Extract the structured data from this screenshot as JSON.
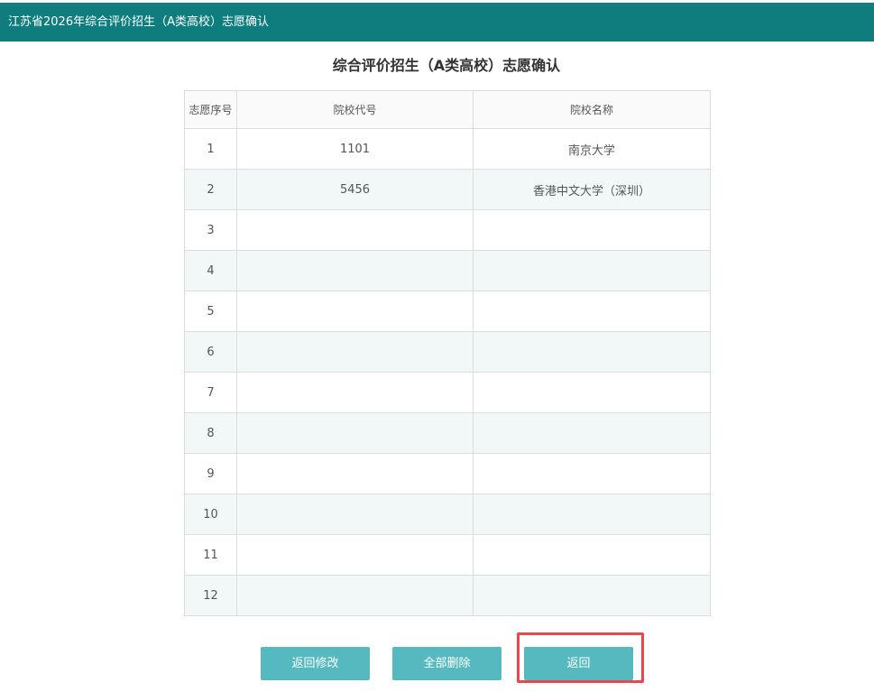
{
  "header": {
    "title": "江苏省2026年综合评价招生（A类高校）志愿确认"
  },
  "page": {
    "title": "综合评价招生（A类高校）志愿确认"
  },
  "table": {
    "columns": [
      "志愿序号",
      "院校代号",
      "院校名称"
    ],
    "rows": [
      {
        "seq": "1",
        "code": "1101",
        "name": "南京大学"
      },
      {
        "seq": "2",
        "code": "5456",
        "name": "香港中文大学（深圳）"
      },
      {
        "seq": "3",
        "code": "",
        "name": ""
      },
      {
        "seq": "4",
        "code": "",
        "name": ""
      },
      {
        "seq": "5",
        "code": "",
        "name": ""
      },
      {
        "seq": "6",
        "code": "",
        "name": ""
      },
      {
        "seq": "7",
        "code": "",
        "name": ""
      },
      {
        "seq": "8",
        "code": "",
        "name": ""
      },
      {
        "seq": "9",
        "code": "",
        "name": ""
      },
      {
        "seq": "10",
        "code": "",
        "name": ""
      },
      {
        "seq": "11",
        "code": "",
        "name": ""
      },
      {
        "seq": "12",
        "code": "",
        "name": ""
      }
    ]
  },
  "buttons": {
    "modify": "返回修改",
    "delete_all": "全部删除",
    "back": "返回"
  },
  "colors": {
    "header_bg": "#0f7d7e",
    "button_bg": "#56b9bf",
    "highlight": "#e8474f",
    "row_alt": "#f2f7f7"
  }
}
